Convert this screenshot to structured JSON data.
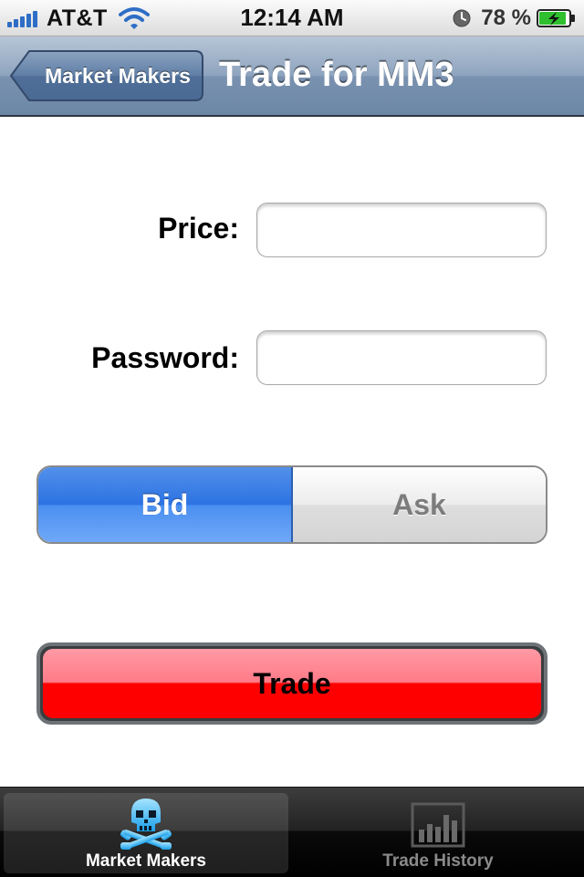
{
  "status_bar": {
    "carrier": "AT&T",
    "time": "12:14 AM",
    "battery_percent": "78 %"
  },
  "nav": {
    "back_label": "Market Makers",
    "title": "Trade for MM3"
  },
  "form": {
    "price_label": "Price:",
    "price_value": "",
    "password_label": "Password:",
    "password_value": ""
  },
  "side_selector": {
    "options": [
      "Bid",
      "Ask"
    ],
    "selected": "Bid"
  },
  "trade_button": {
    "label": "Trade"
  },
  "tab_bar": {
    "tabs": [
      {
        "label": "Market Makers",
        "icon": "skull-crossbones-icon",
        "active": true
      },
      {
        "label": "Trade History",
        "icon": "bar-chart-icon",
        "active": false
      }
    ]
  },
  "colors": {
    "nav_bar": "#8ea4be",
    "selected_segment": "#2c72e2",
    "trade_button": "#ff0000",
    "tab_bar": "#000000"
  }
}
